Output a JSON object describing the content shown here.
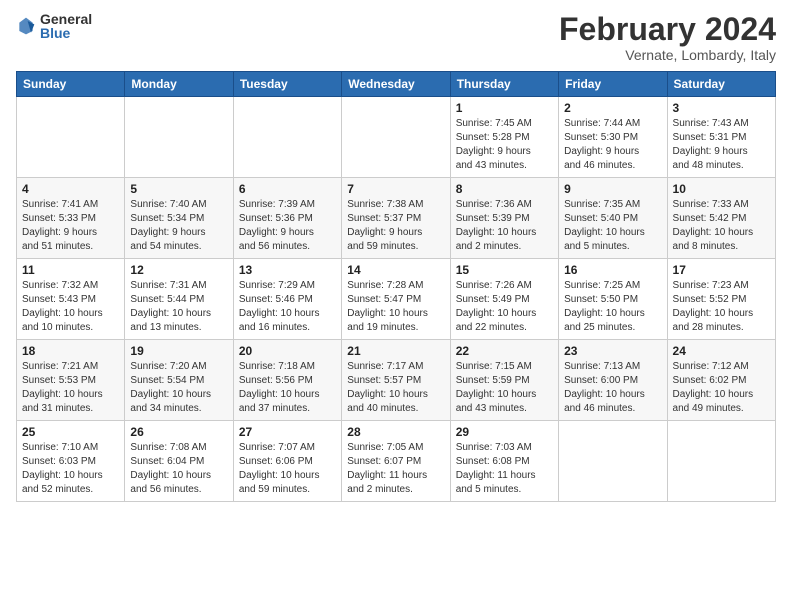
{
  "logo": {
    "general": "General",
    "blue": "Blue"
  },
  "title": "February 2024",
  "subtitle": "Vernate, Lombardy, Italy",
  "days_of_week": [
    "Sunday",
    "Monday",
    "Tuesday",
    "Wednesday",
    "Thursday",
    "Friday",
    "Saturday"
  ],
  "weeks": [
    [
      {
        "day": "",
        "info": ""
      },
      {
        "day": "",
        "info": ""
      },
      {
        "day": "",
        "info": ""
      },
      {
        "day": "",
        "info": ""
      },
      {
        "day": "1",
        "info": "Sunrise: 7:45 AM\nSunset: 5:28 PM\nDaylight: 9 hours\nand 43 minutes."
      },
      {
        "day": "2",
        "info": "Sunrise: 7:44 AM\nSunset: 5:30 PM\nDaylight: 9 hours\nand 46 minutes."
      },
      {
        "day": "3",
        "info": "Sunrise: 7:43 AM\nSunset: 5:31 PM\nDaylight: 9 hours\nand 48 minutes."
      }
    ],
    [
      {
        "day": "4",
        "info": "Sunrise: 7:41 AM\nSunset: 5:33 PM\nDaylight: 9 hours\nand 51 minutes."
      },
      {
        "day": "5",
        "info": "Sunrise: 7:40 AM\nSunset: 5:34 PM\nDaylight: 9 hours\nand 54 minutes."
      },
      {
        "day": "6",
        "info": "Sunrise: 7:39 AM\nSunset: 5:36 PM\nDaylight: 9 hours\nand 56 minutes."
      },
      {
        "day": "7",
        "info": "Sunrise: 7:38 AM\nSunset: 5:37 PM\nDaylight: 9 hours\nand 59 minutes."
      },
      {
        "day": "8",
        "info": "Sunrise: 7:36 AM\nSunset: 5:39 PM\nDaylight: 10 hours\nand 2 minutes."
      },
      {
        "day": "9",
        "info": "Sunrise: 7:35 AM\nSunset: 5:40 PM\nDaylight: 10 hours\nand 5 minutes."
      },
      {
        "day": "10",
        "info": "Sunrise: 7:33 AM\nSunset: 5:42 PM\nDaylight: 10 hours\nand 8 minutes."
      }
    ],
    [
      {
        "day": "11",
        "info": "Sunrise: 7:32 AM\nSunset: 5:43 PM\nDaylight: 10 hours\nand 10 minutes."
      },
      {
        "day": "12",
        "info": "Sunrise: 7:31 AM\nSunset: 5:44 PM\nDaylight: 10 hours\nand 13 minutes."
      },
      {
        "day": "13",
        "info": "Sunrise: 7:29 AM\nSunset: 5:46 PM\nDaylight: 10 hours\nand 16 minutes."
      },
      {
        "day": "14",
        "info": "Sunrise: 7:28 AM\nSunset: 5:47 PM\nDaylight: 10 hours\nand 19 minutes."
      },
      {
        "day": "15",
        "info": "Sunrise: 7:26 AM\nSunset: 5:49 PM\nDaylight: 10 hours\nand 22 minutes."
      },
      {
        "day": "16",
        "info": "Sunrise: 7:25 AM\nSunset: 5:50 PM\nDaylight: 10 hours\nand 25 minutes."
      },
      {
        "day": "17",
        "info": "Sunrise: 7:23 AM\nSunset: 5:52 PM\nDaylight: 10 hours\nand 28 minutes."
      }
    ],
    [
      {
        "day": "18",
        "info": "Sunrise: 7:21 AM\nSunset: 5:53 PM\nDaylight: 10 hours\nand 31 minutes."
      },
      {
        "day": "19",
        "info": "Sunrise: 7:20 AM\nSunset: 5:54 PM\nDaylight: 10 hours\nand 34 minutes."
      },
      {
        "day": "20",
        "info": "Sunrise: 7:18 AM\nSunset: 5:56 PM\nDaylight: 10 hours\nand 37 minutes."
      },
      {
        "day": "21",
        "info": "Sunrise: 7:17 AM\nSunset: 5:57 PM\nDaylight: 10 hours\nand 40 minutes."
      },
      {
        "day": "22",
        "info": "Sunrise: 7:15 AM\nSunset: 5:59 PM\nDaylight: 10 hours\nand 43 minutes."
      },
      {
        "day": "23",
        "info": "Sunrise: 7:13 AM\nSunset: 6:00 PM\nDaylight: 10 hours\nand 46 minutes."
      },
      {
        "day": "24",
        "info": "Sunrise: 7:12 AM\nSunset: 6:02 PM\nDaylight: 10 hours\nand 49 minutes."
      }
    ],
    [
      {
        "day": "25",
        "info": "Sunrise: 7:10 AM\nSunset: 6:03 PM\nDaylight: 10 hours\nand 52 minutes."
      },
      {
        "day": "26",
        "info": "Sunrise: 7:08 AM\nSunset: 6:04 PM\nDaylight: 10 hours\nand 56 minutes."
      },
      {
        "day": "27",
        "info": "Sunrise: 7:07 AM\nSunset: 6:06 PM\nDaylight: 10 hours\nand 59 minutes."
      },
      {
        "day": "28",
        "info": "Sunrise: 7:05 AM\nSunset: 6:07 PM\nDaylight: 11 hours\nand 2 minutes."
      },
      {
        "day": "29",
        "info": "Sunrise: 7:03 AM\nSunset: 6:08 PM\nDaylight: 11 hours\nand 5 minutes."
      },
      {
        "day": "",
        "info": ""
      },
      {
        "day": "",
        "info": ""
      }
    ]
  ]
}
